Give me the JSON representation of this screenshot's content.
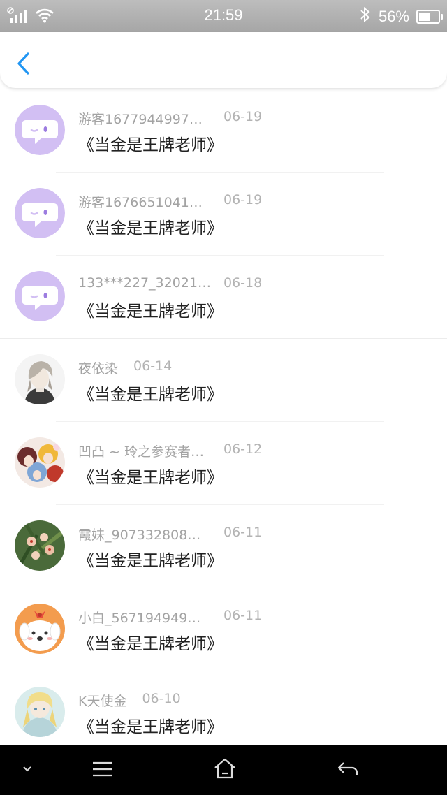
{
  "status": {
    "time": "21:59",
    "battery_text": "56%",
    "battery_level": 0.56
  },
  "messages": [
    {
      "name": "游客1677944997…",
      "date": "06-19",
      "title": "《当金是王牌老师》",
      "avatar": "chat-bubble-icon"
    },
    {
      "name": "游客1676651041…",
      "date": "06-19",
      "title": "《当金是王牌老师》",
      "avatar": "chat-bubble-icon"
    },
    {
      "name": "133***227_32021…",
      "date": "06-18",
      "title": "《当金是王牌老师》",
      "avatar": "chat-bubble-icon"
    },
    {
      "name": "夜依染",
      "date": "06-14",
      "title": "《当金是王牌老师》",
      "avatar": "anime-boy-avatar"
    },
    {
      "name": "凹凸 ~ 玲之参赛者…",
      "date": "06-12",
      "title": "《当金是王牌老师》",
      "avatar": "anime-group-avatar"
    },
    {
      "name": "霞妹_907332808…",
      "date": "06-11",
      "title": "《当金是王牌老师》",
      "avatar": "orchid-flower-avatar"
    },
    {
      "name": "小白_567194949…",
      "date": "06-11",
      "title": "《当金是王牌老师》",
      "avatar": "cute-dog-avatar"
    },
    {
      "name": "K天使金",
      "date": "06-10",
      "title": "《当金是王牌老师》",
      "avatar": "anime-angel-avatar"
    }
  ],
  "colors": {
    "accent": "#2196F3",
    "bubble_avatar_bg": "#D2BFF3",
    "status_bar": "#A8A8A8",
    "system_nav": "#000000"
  }
}
